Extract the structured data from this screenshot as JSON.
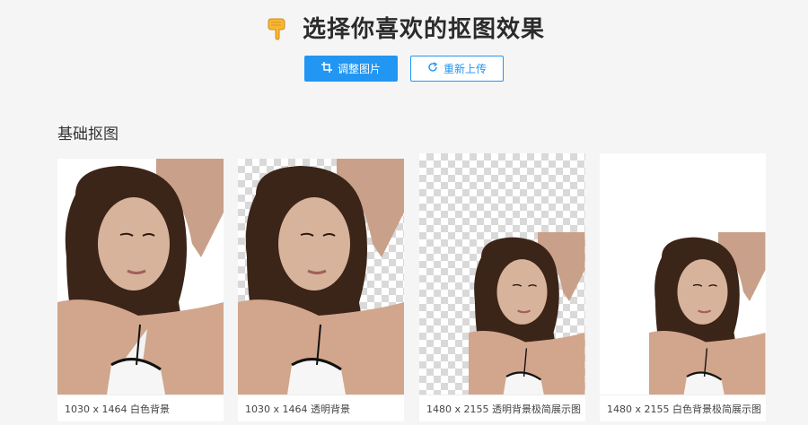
{
  "header": {
    "title": "选择你喜欢的抠图效果",
    "icon": "pointing-down-hand-icon"
  },
  "toolbar": {
    "adjust_label": "调整图片",
    "reupload_label": "重新上传",
    "accent_color": "#2196f3"
  },
  "section": {
    "title": "基础抠图"
  },
  "cards": [
    {
      "caption": "1030 x 1464 白色背景",
      "background": "white"
    },
    {
      "caption": "1030 x 1464 透明背景",
      "background": "transparent"
    },
    {
      "caption": "1480 x 2155 透明背景极简展示图",
      "background": "transparent"
    },
    {
      "caption": "1480 x 2155 白色背景极简展示图",
      "background": "white"
    }
  ]
}
